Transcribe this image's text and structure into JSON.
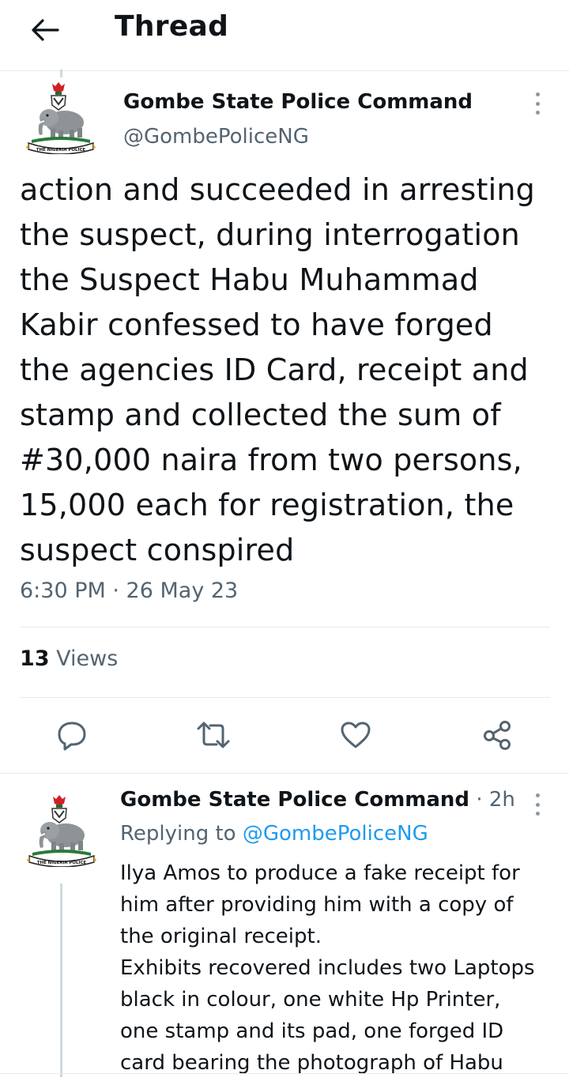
{
  "header": {
    "title": "Thread",
    "back_icon": "arrow-left-icon"
  },
  "colors": {
    "text": "#0f1419",
    "secondary": "#536471",
    "accent": "#1d9bf0",
    "divider": "#e6ecf0"
  },
  "main_tweet": {
    "author_name": "Gombe State Police Command",
    "author_handle": "@GombePoliceNG",
    "avatar_label": "THE NIGERIA POLICE",
    "text_lines": [
      "action and succeeded in arresting",
      "the suspect, during interrogation",
      "the Suspect Habu Muhammad",
      "Kabir confessed to have forged",
      "the agencies ID Card, receipt and",
      "stamp and collected the sum of",
      "#30,000 naira from two persons,",
      "15,000 each for registration, the",
      "suspect conspired"
    ],
    "timestamp": "6:30 PM · 26 May 23",
    "views_count": "13",
    "views_label": "Views",
    "actions": [
      "reply-icon",
      "retweet-icon",
      "like-icon",
      "share-icon"
    ]
  },
  "reply_tweet": {
    "author_name": "Gombe State Police Command",
    "separator": "·",
    "time": "2h",
    "avatar_label": "THE NIGERIA POLICE",
    "replying_prefix": "Replying to",
    "replying_handle": "@GombePoliceNG",
    "text_lines": [
      "Ilya Amos to produce a fake receipt for",
      "him after providing him with a copy of",
      "the original receipt.",
      "Exhibits recovered includes two Laptops",
      "black in colour, one white Hp Printer,",
      "one stamp and its pad, one forged ID",
      "card bearing the photograph of Habu"
    ]
  }
}
